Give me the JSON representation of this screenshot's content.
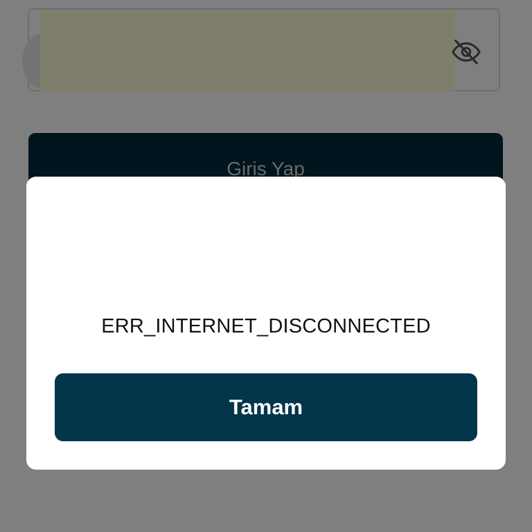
{
  "login": {
    "password_field": {
      "value_masked": "",
      "visibility_icon": "eye-off-icon"
    },
    "login_button_label": "Giris Yap"
  },
  "dialog": {
    "message": "ERR_INTERNET_DISCONNECTED",
    "ok_button_label": "Tamam"
  },
  "colors": {
    "login_button_bg": "#012a3a",
    "ok_button_bg": "#03354b",
    "autofill_bg": "#fffdd5",
    "overlay": "rgba(0,0,0,0.5)"
  }
}
